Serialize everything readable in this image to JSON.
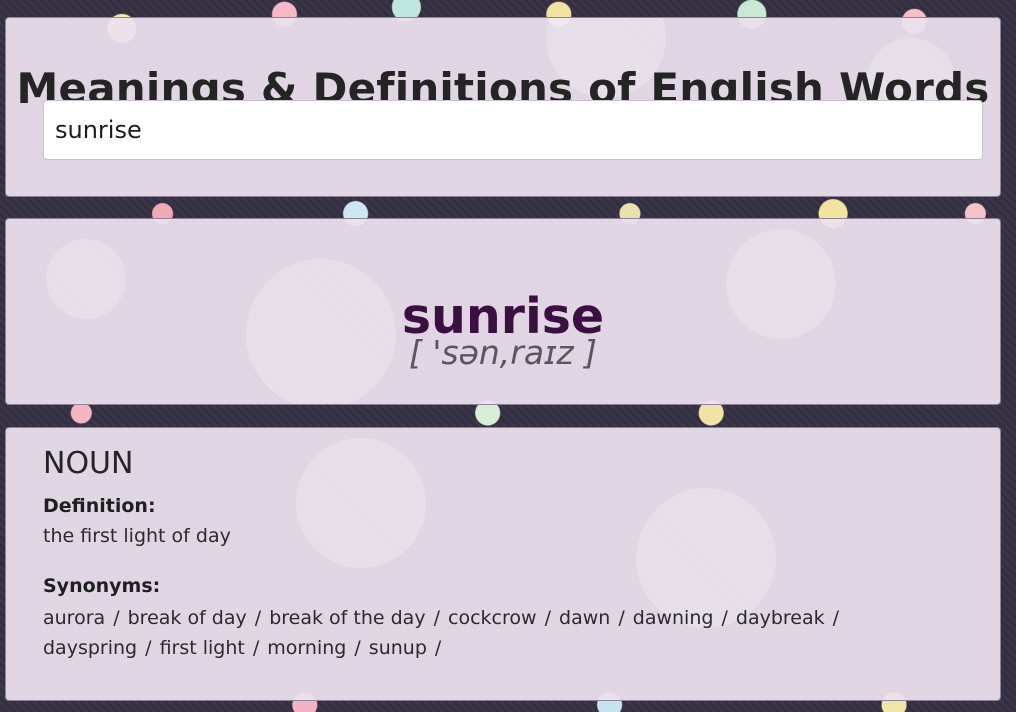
{
  "header": {
    "title": "Meanings & Definitions of English Words",
    "search_value": "sunrise"
  },
  "word": {
    "text": "sunrise",
    "phonetic": "[ 'sən,raɪz ]"
  },
  "meaning": {
    "part_of_speech": "NOUN",
    "definition_label": "Definition:",
    "definition": "the first light of day",
    "synonyms_label": "Synonyms:",
    "separator": "/",
    "synonyms": [
      "aurora",
      "break of day",
      "break of the day",
      "cockcrow",
      "dawn",
      "dawning",
      "daybreak",
      "dayspring",
      "first light",
      "morning",
      "sunup"
    ]
  }
}
